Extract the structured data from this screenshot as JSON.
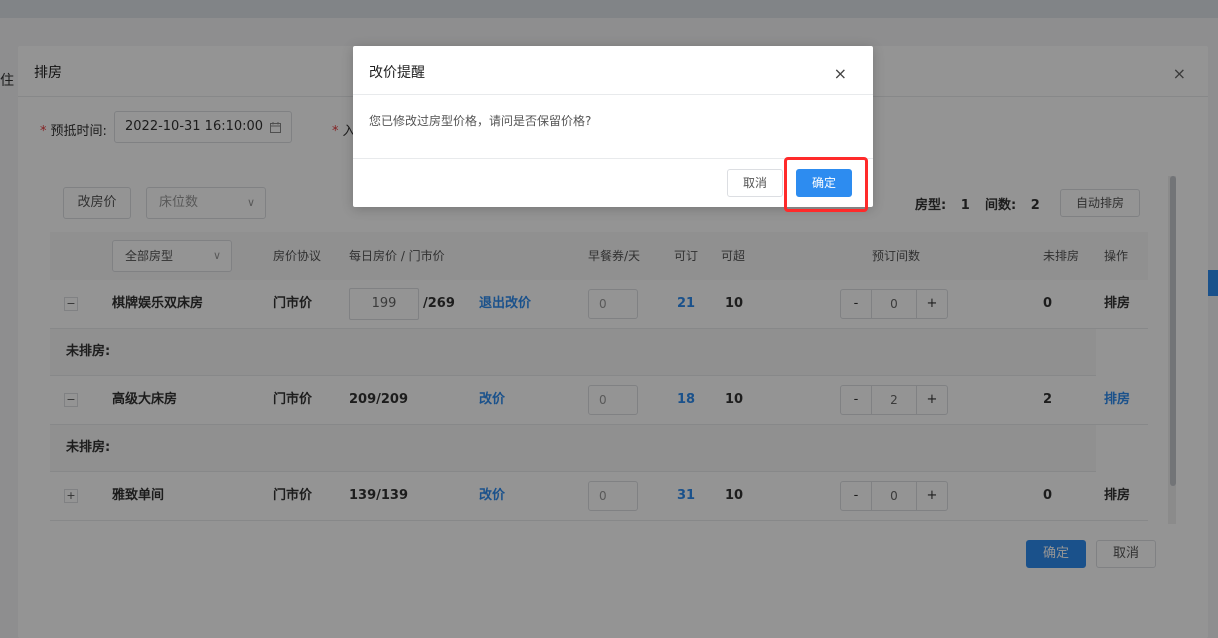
{
  "background": {
    "left_text": "住"
  },
  "main_dialog": {
    "title": "排房",
    "close_glyph": "×",
    "checkout_label": "预抵时间:",
    "checkout_value": "2022-10-31 16:10:00",
    "checkin_label_partial": "入",
    "change_price_button": "改房价",
    "bed_select_placeholder": "床位数",
    "room_type_label": "房型:",
    "room_type_count": "1",
    "room_count_label": "间数:",
    "room_count": "2",
    "auto_assign_button": "自动排房",
    "confirm_button": "确定",
    "cancel_button": "取消"
  },
  "table": {
    "room_type_filter": "全部房型",
    "headers": {
      "protocol": "房价协议",
      "price": "每日房价 / 门市价",
      "breakfast": "早餐券/天",
      "available": "可订",
      "overbook": "可超",
      "booked": "预订间数",
      "unassigned": "未排房",
      "action": "操作"
    },
    "rows": [
      {
        "toggle": "−",
        "name": "棋牌娱乐双床房",
        "protocol": "门市价",
        "price_input": "199",
        "price_suffix": "/269",
        "price_action": "退出改价",
        "breakfast": "0",
        "available": "21",
        "overbook": "10",
        "booked": "0",
        "unassigned": "0",
        "action": "排房",
        "sub_label": "未排房:"
      },
      {
        "toggle": "−",
        "name": "高级大床房",
        "protocol": "门市价",
        "price_text": "209/209",
        "price_action": "改价",
        "breakfast": "0",
        "available": "18",
        "overbook": "10",
        "booked": "2",
        "unassigned": "2",
        "action": "排房",
        "sub_label": "未排房:"
      },
      {
        "toggle": "+",
        "name": "雅致单间",
        "protocol": "门市价",
        "price_text": "139/139",
        "price_action": "改价",
        "breakfast": "0",
        "available": "31",
        "overbook": "10",
        "booked": "0",
        "unassigned": "0",
        "action": "排房"
      }
    ],
    "stepper_minus": "-",
    "stepper_plus": "+"
  },
  "confirm_modal": {
    "title": "改价提醒",
    "close_glyph": "×",
    "message": "您已修改过房型价格，请问是否保留价格?",
    "cancel_button": "取消",
    "confirm_button": "确定"
  },
  "colors": {
    "accent": "#2d8cf0",
    "highlight": "#ff2a2a"
  },
  "icons": [
    "calendar-icon",
    "chevron-down-icon",
    "close-icon"
  ]
}
